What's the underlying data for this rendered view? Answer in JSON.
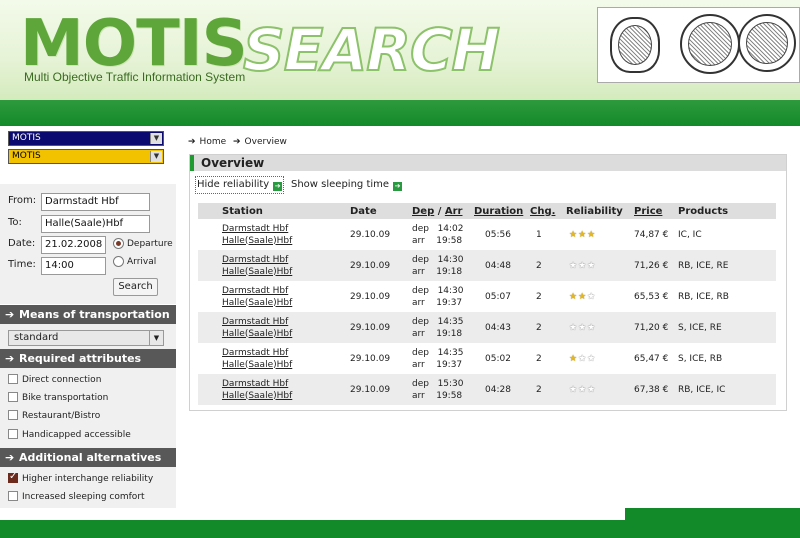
{
  "header": {
    "logo_motis": "MOTIS",
    "logo_search": "SEARCH",
    "subtitle": "Multi Objective Traffic Information System"
  },
  "sidebar": {
    "select1": "MOTIS",
    "select2": "MOTIS",
    "form": {
      "from_label": "From:",
      "from_value": "Darmstadt Hbf",
      "to_label": "To:",
      "to_value": "Halle(Saale)Hbf",
      "date_label": "Date:",
      "date_value": "21.02.2008",
      "time_label": "Time:",
      "time_value": "14:00",
      "departure_label": "Departure",
      "arrival_label": "Arrival",
      "selected_mode": "Departure",
      "search_label": "Search"
    },
    "transport": {
      "heading": "Means of transportation",
      "selected": "standard"
    },
    "required": {
      "heading": "Required attributes",
      "items": [
        {
          "label": "Direct connection",
          "checked": false
        },
        {
          "label": "Bike transportation",
          "checked": false
        },
        {
          "label": "Restaurant/Bistro",
          "checked": false
        },
        {
          "label": "Handicapped accessible",
          "checked": false
        }
      ]
    },
    "alternatives": {
      "heading": "Additional alternatives with",
      "items": [
        {
          "label": "Higher interchange reliability",
          "checked": true
        },
        {
          "label": "Increased sleeping comfort",
          "checked": false
        }
      ]
    }
  },
  "breadcrumb": {
    "home": "Home",
    "current": "Overview"
  },
  "overview": {
    "title": "Overview",
    "hide_reliability": "Hide reliability",
    "show_sleeping": "Show sleeping time",
    "columns": {
      "station": "Station",
      "date": "Date",
      "dep": "Dep",
      "sep": "/",
      "arr": "Arr",
      "duration": "Duration",
      "changes": "Chg.",
      "reliability": "Reliability",
      "price": "Price",
      "products": "Products"
    },
    "rows": [
      {
        "from": "Darmstadt Hbf",
        "to": "Halle(Saale)Hbf",
        "date": "29.10.09",
        "dep_l": "dep",
        "dep": "14:02",
        "arr_l": "arr",
        "arr": "19:58",
        "duration": "05:56",
        "changes": "1",
        "reliability": 3,
        "price": "74,87 €",
        "products": "IC, IC"
      },
      {
        "from": "Darmstadt Hbf",
        "to": "Halle(Saale)Hbf",
        "date": "29.10.09",
        "dep_l": "dep",
        "dep": "14:30",
        "arr_l": "arr",
        "arr": "19:18",
        "duration": "04:48",
        "changes": "2",
        "reliability": 0,
        "price": "71,26 €",
        "products": "RB, ICE, RE"
      },
      {
        "from": "Darmstadt Hbf",
        "to": "Halle(Saale)Hbf",
        "date": "29.10.09",
        "dep_l": "dep",
        "dep": "14:30",
        "arr_l": "arr",
        "arr": "19:37",
        "duration": "05:07",
        "changes": "2",
        "reliability": 2,
        "price": "65,53 €",
        "products": "RB, ICE, RB"
      },
      {
        "from": "Darmstadt Hbf",
        "to": "Halle(Saale)Hbf",
        "date": "29.10.09",
        "dep_l": "dep",
        "dep": "14:35",
        "arr_l": "arr",
        "arr": "19:18",
        "duration": "04:43",
        "changes": "2",
        "reliability": 0,
        "price": "71,20 €",
        "products": "S, ICE, RE"
      },
      {
        "from": "Darmstadt Hbf",
        "to": "Halle(Saale)Hbf",
        "date": "29.10.09",
        "dep_l": "dep",
        "dep": "14:35",
        "arr_l": "arr",
        "arr": "19:37",
        "duration": "05:02",
        "changes": "2",
        "reliability": 1,
        "price": "65,47 €",
        "products": "S, ICE, RB"
      },
      {
        "from": "Darmstadt Hbf",
        "to": "Halle(Saale)Hbf",
        "date": "29.10.09",
        "dep_l": "dep",
        "dep": "15:30",
        "arr_l": "arr",
        "arr": "19:58",
        "duration": "04:28",
        "changes": "2",
        "reliability": 0,
        "price": "67,38 €",
        "products": "RB, ICE, IC"
      }
    ]
  },
  "colors": {
    "accent": "#138a2a",
    "select_blue": "#0a0a70",
    "select_yellow": "#f2c200",
    "star": "#e8b712"
  }
}
